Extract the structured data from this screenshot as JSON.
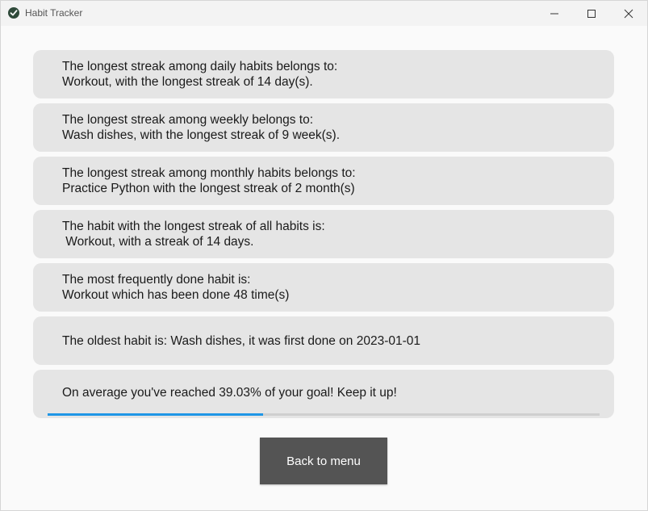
{
  "window": {
    "title": "Habit Tracker",
    "icon": "checkmark-icon",
    "controls": [
      "minimize-icon",
      "maximize-icon",
      "close-icon"
    ]
  },
  "stats": {
    "daily": {
      "line1": "The longest streak among daily habits belongs to:",
      "line2": "Workout, with the longest streak of 14 day(s)."
    },
    "weekly": {
      "line1": "The longest streak among weekly belongs to:",
      "line2": "Wash dishes, with the longest streak of 9 week(s)."
    },
    "monthly": {
      "line1": "The longest streak among monthly habits belongs to:",
      "line2": "Practice Python with the longest streak of 2 month(s)"
    },
    "overall": {
      "line1": "The habit with the longest streak of all habits is:",
      "line2": " Workout, with a streak of 14 days."
    },
    "frequent": {
      "line1": "The most frequently done habit is:",
      "line2": "Workout which has been done 48 time(s)"
    },
    "oldest": {
      "line1": "The oldest habit is: Wash dishes, it was first done on 2023-01-01"
    },
    "average": {
      "line1": "On average you've reached 39.03% of your goal! Keep it up!",
      "progress_fraction": 0.3903
    }
  },
  "back_button": {
    "label": "Back to menu"
  },
  "colors": {
    "card_bg": "#e5e5e5",
    "progress_fill": "#1f96e6",
    "progress_track": "#cfcfcf",
    "button_bg": "#545454"
  }
}
